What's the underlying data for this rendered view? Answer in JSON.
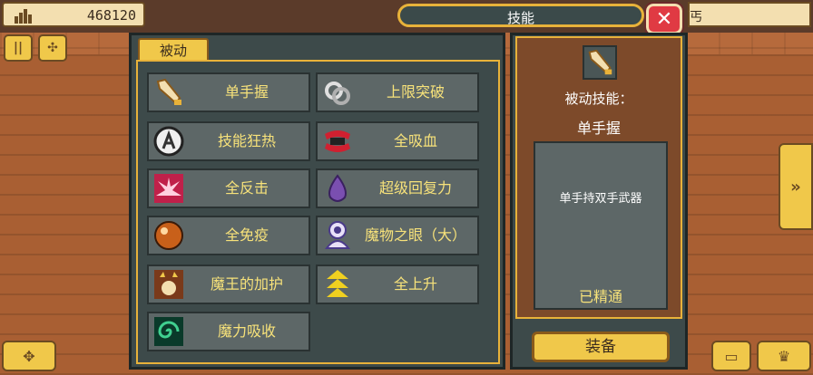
{
  "hud": {
    "gold_value": "468120",
    "right_partial_text": "丐"
  },
  "window": {
    "title": "技能",
    "close_label": "✕"
  },
  "tabs": [
    {
      "label": "被动"
    }
  ],
  "skills": [
    {
      "label": "单手握",
      "icon": "sword-icon"
    },
    {
      "label": "上限突破",
      "icon": "broken-chain-icon"
    },
    {
      "label": "技能狂热",
      "icon": "orb-icon"
    },
    {
      "label": "全吸血",
      "icon": "fangs-icon"
    },
    {
      "label": "全反击",
      "icon": "burst-icon"
    },
    {
      "label": "超级回复力",
      "icon": "potion-drop-icon"
    },
    {
      "label": "全免疫",
      "icon": "amber-orb-icon"
    },
    {
      "label": "魔物之眼（大）",
      "icon": "monster-eye-icon"
    },
    {
      "label": "魔王的加护",
      "icon": "demon-king-icon"
    },
    {
      "label": "全上升",
      "icon": "triple-arrow-up-icon"
    },
    {
      "label": "魔力吸收",
      "icon": "vortex-icon"
    }
  ],
  "detail": {
    "type_label": "被动技能：",
    "name": "单手握",
    "description": "单手持双手武器",
    "status": "已精通",
    "equip_label": "装备"
  }
}
